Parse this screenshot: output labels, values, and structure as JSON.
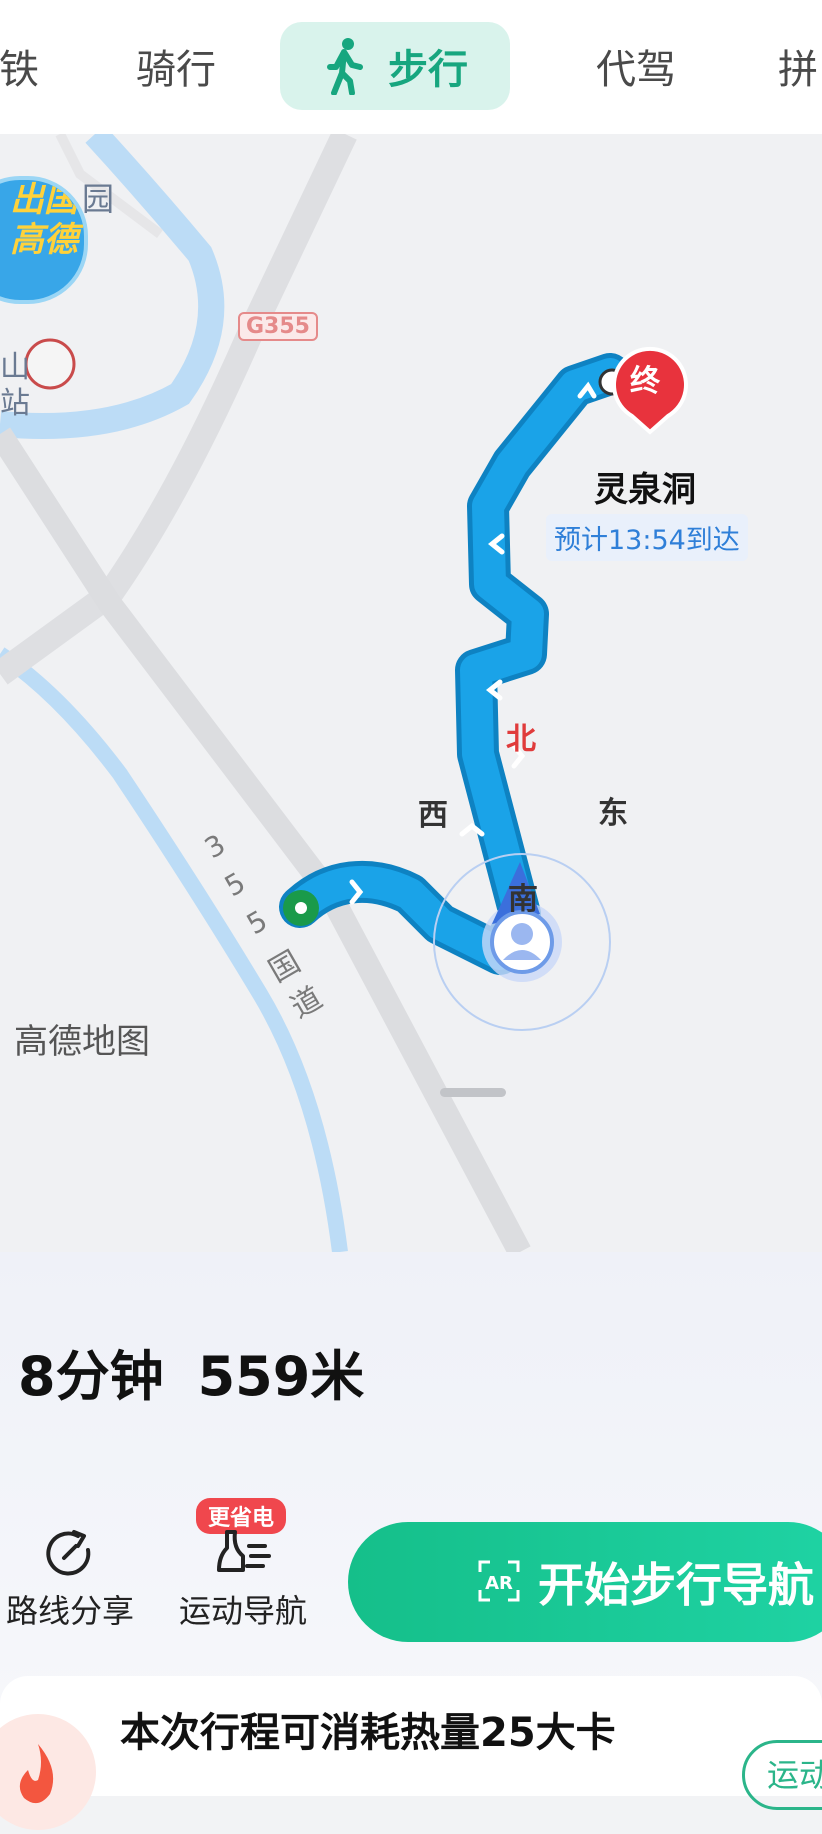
{
  "tabs": [
    {
      "label": "铁",
      "active": false
    },
    {
      "label": "骑行",
      "active": false
    },
    {
      "label": "步行",
      "active": true
    },
    {
      "label": "代驾",
      "active": false
    },
    {
      "label": "拼",
      "active": false
    }
  ],
  "map": {
    "promo_text": [
      "出国",
      "高德"
    ],
    "poi_fragments": [
      "园",
      "山",
      "站"
    ],
    "road_shield": "G355",
    "road_name": [
      "3",
      "5",
      "5",
      "国",
      "道"
    ],
    "end_marker": "终",
    "destination": "灵泉洞",
    "eta": "预计13:54到达",
    "compass": {
      "north": "北",
      "east": "东",
      "south": "南",
      "west": "西"
    },
    "watermark": "高德地图"
  },
  "summary": {
    "duration": "8分钟",
    "distance": "559米"
  },
  "actions": {
    "share_label": "路线分享",
    "sport_nav_label": "运动导航",
    "sport_nav_badge": "更省电",
    "start_button": "开始步行导航"
  },
  "calorie": {
    "text": "本次行程可消耗热量25大卡",
    "button": "运动"
  },
  "colors": {
    "accent": "#17a67f",
    "route": "#1aa3e8",
    "end_marker": "#e8333d",
    "start_marker": "#1a9a4a"
  }
}
